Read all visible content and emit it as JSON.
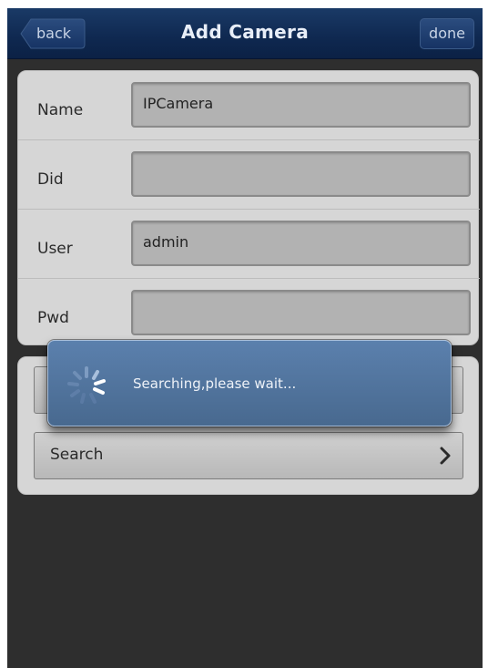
{
  "nav": {
    "title": "Add Camera",
    "back_label": "back",
    "done_label": "done"
  },
  "form": {
    "fields": [
      {
        "label": "Name",
        "value": "IPCamera"
      },
      {
        "label": "Did",
        "value": ""
      },
      {
        "label": "User",
        "value": "admin"
      },
      {
        "label": "Pwd",
        "value": ""
      }
    ]
  },
  "actions": {
    "search_label": "Search"
  },
  "loading": {
    "message": "Searching,please wait..."
  },
  "colors": {
    "navbar": "#0f2850",
    "popup": "#5374a0",
    "background": "#2e2e2e"
  }
}
